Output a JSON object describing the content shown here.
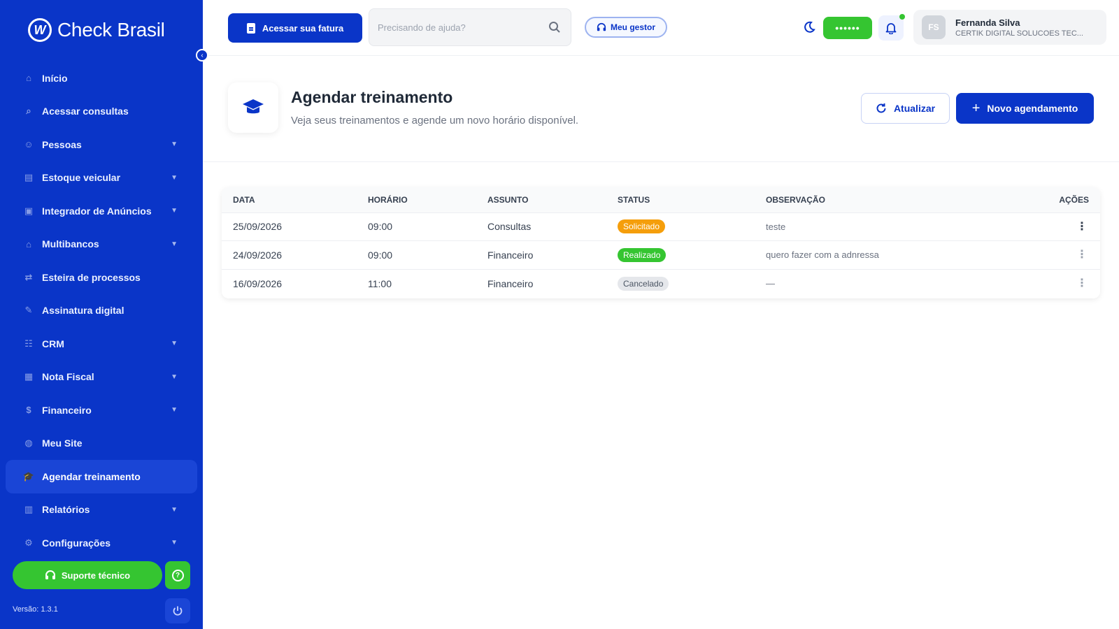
{
  "app": {
    "name": "Check Brasil",
    "logo_glyph": "W"
  },
  "sidebar": {
    "items": [
      {
        "label": "Início",
        "icon": "home-icon",
        "glyph": "⌂",
        "chevron": false,
        "active": false
      },
      {
        "label": "Acessar consultas",
        "icon": "search-icon",
        "glyph": "⌕",
        "chevron": false,
        "active": false
      },
      {
        "label": "Pessoas",
        "icon": "people-icon",
        "glyph": "☺",
        "chevron": true,
        "active": false
      },
      {
        "label": "Estoque veicular",
        "icon": "car-icon",
        "glyph": "▤",
        "chevron": true,
        "active": false
      },
      {
        "label": "Integrador de Anúncios",
        "icon": "megaphone-icon",
        "glyph": "▣",
        "chevron": true,
        "active": false
      },
      {
        "label": "Multibancos",
        "icon": "bank-icon",
        "glyph": "⌂",
        "chevron": true,
        "active": false
      },
      {
        "label": "Esteira de processos",
        "icon": "flow-icon",
        "glyph": "⇄",
        "chevron": false,
        "active": false
      },
      {
        "label": "Assinatura digital",
        "icon": "signature-icon",
        "glyph": "✎",
        "chevron": false,
        "active": false
      },
      {
        "label": "CRM",
        "icon": "crm-icon",
        "glyph": "☷",
        "chevron": true,
        "active": false
      },
      {
        "label": "Nota Fiscal",
        "icon": "invoice-icon",
        "glyph": "▦",
        "chevron": true,
        "active": false
      },
      {
        "label": "Financeiro",
        "icon": "money-icon",
        "glyph": "$",
        "chevron": true,
        "active": false
      },
      {
        "label": "Meu Site",
        "icon": "globe-icon",
        "glyph": "◍",
        "chevron": false,
        "active": false
      },
      {
        "label": "Agendar treinamento",
        "icon": "graduation-cap-icon",
        "glyph": "🎓",
        "chevron": false,
        "active": true
      },
      {
        "label": "Relatórios",
        "icon": "chart-icon",
        "glyph": "▥",
        "chevron": true,
        "active": false
      },
      {
        "label": "Configurações",
        "icon": "gear-icon",
        "glyph": "⚙",
        "chevron": true,
        "active": false
      }
    ],
    "support_label": "Suporte técnico",
    "version": "Versão: 1.3.1"
  },
  "topbar": {
    "invoice_label": "Acessar sua fatura",
    "search_placeholder": "Precisando de ajuda?",
    "manager_label": "Meu gestor",
    "balance_masked": "••••••",
    "user": {
      "initials": "FS",
      "name": "Fernanda Silva",
      "company": "CERTIK DIGITAL SOLUCOES TEC..."
    }
  },
  "page": {
    "title": "Agendar treinamento",
    "subtitle": "Veja seus treinamentos e agende um novo horário disponível.",
    "refresh_label": "Atualizar",
    "new_label": "Novo agendamento"
  },
  "table": {
    "headers": [
      "DATA",
      "HORÁRIO",
      "ASSUNTO",
      "STATUS",
      "OBSERVAÇÃO",
      "AÇÕES"
    ],
    "rows": [
      {
        "data": "25/09/2026",
        "horario": "09:00",
        "assunto": "Consultas",
        "status": "Solicitado",
        "observacao": "teste"
      },
      {
        "data": "24/09/2026",
        "horario": "09:00",
        "assunto": "Financeiro",
        "status": "Realizado",
        "observacao": "quero fazer com a adnressa"
      },
      {
        "data": "16/09/2026",
        "horario": "11:00",
        "assunto": "Financeiro",
        "status": "Cancelado",
        "observacao": "—"
      }
    ]
  },
  "colors": {
    "brand": "#0a35c8",
    "green": "#35c531",
    "solicitado": "#f59e0b",
    "realizado": "#35c531",
    "cancelado": "#e5e7eb"
  }
}
